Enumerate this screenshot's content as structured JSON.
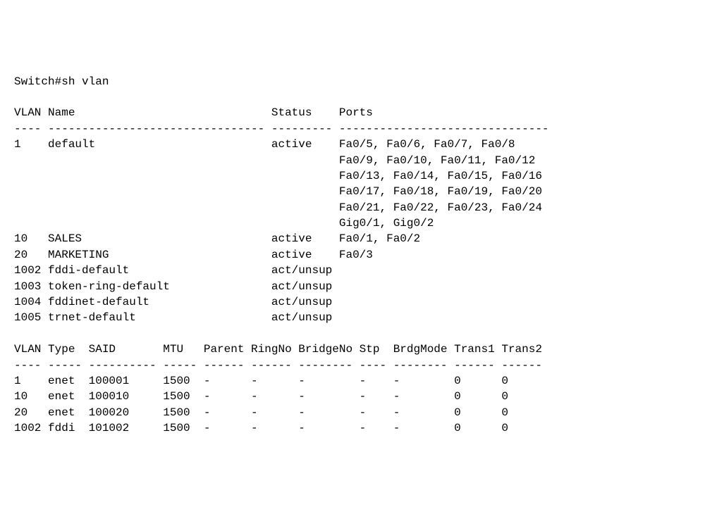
{
  "command_line": "Switch#sh vlan",
  "table1": {
    "header": "VLAN Name                             Status    Ports",
    "divider": "---- -------------------------------- --------- -------------------------------",
    "rows": [
      "1    default                          active    Fa0/5, Fa0/6, Fa0/7, Fa0/8",
      "                                                Fa0/9, Fa0/10, Fa0/11, Fa0/12",
      "                                                Fa0/13, Fa0/14, Fa0/15, Fa0/16",
      "                                                Fa0/17, Fa0/18, Fa0/19, Fa0/20",
      "                                                Fa0/21, Fa0/22, Fa0/23, Fa0/24",
      "                                                Gig0/1, Gig0/2",
      "10   SALES                            active    Fa0/1, Fa0/2",
      "20   MARKETING                        active    Fa0/3",
      "1002 fddi-default                     act/unsup",
      "1003 token-ring-default               act/unsup",
      "1004 fddinet-default                  act/unsup",
      "1005 trnet-default                    act/unsup"
    ]
  },
  "table2": {
    "header": "VLAN Type  SAID       MTU   Parent RingNo BridgeNo Stp  BrdgMode Trans1 Trans2",
    "divider": "---- ----- ---------- ----- ------ ------ -------- ---- -------- ------ ------",
    "rows": [
      "1    enet  100001     1500  -      -      -        -    -        0      0",
      "10   enet  100010     1500  -      -      -        -    -        0      0",
      "20   enet  100020     1500  -      -      -        -    -        0      0",
      "1002 fddi  101002     1500  -      -      -        -    -        0      0"
    ]
  }
}
